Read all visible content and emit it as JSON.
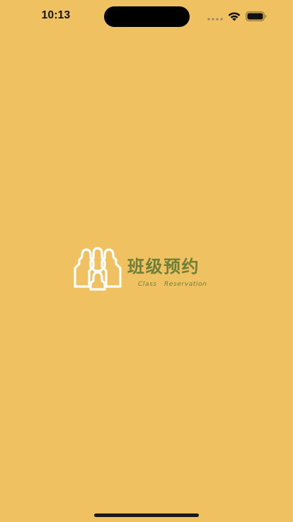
{
  "status_bar": {
    "time": "10:13"
  },
  "logo": {
    "title": "班级预约",
    "subtitle": "Class   Reservation",
    "mark_icon": "people-group-icon"
  },
  "colors": {
    "background": "#EFC160",
    "brand_text": "#6E7F3A",
    "logo_mark": "#FFFFFF"
  }
}
